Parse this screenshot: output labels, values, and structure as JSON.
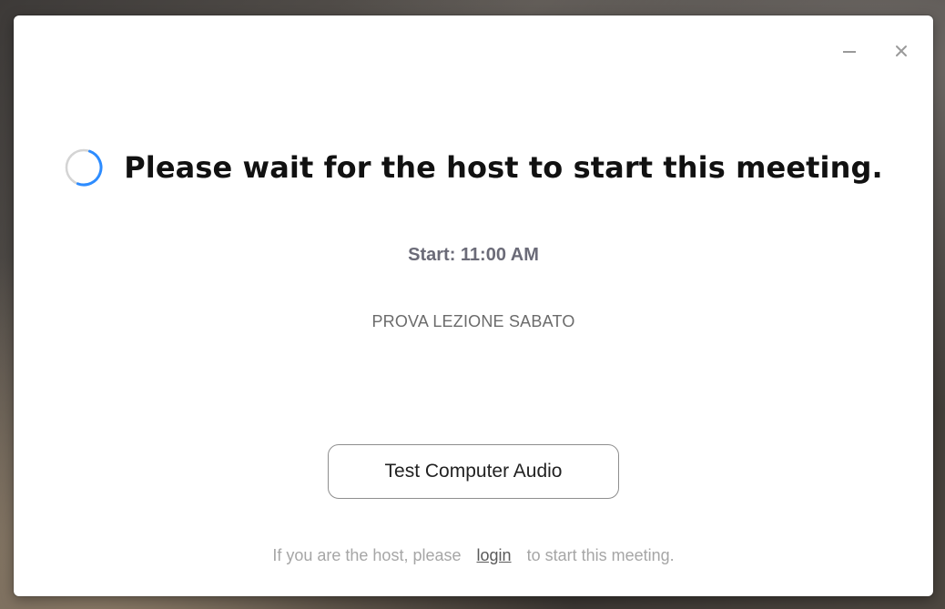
{
  "dialog": {
    "window_controls": {
      "minimize_icon": "minimize-icon",
      "close_icon": "close-icon"
    },
    "headline": {
      "spinner_icon": "loading-spinner-icon",
      "text": "Please wait for the host to start this meeting."
    },
    "start_time": "Start: 11:00 AM",
    "meeting_topic": "PROVA LEZIONE SABATO",
    "test_audio_button": "Test Computer Audio",
    "footer": {
      "prefix": "If you are the host, please",
      "link": "login",
      "suffix": "to start this meeting."
    }
  },
  "colors": {
    "spinner_track": "#d4d4d4",
    "spinner_arc": "#2d8cff",
    "title": "#111111",
    "start_time": "#6b6b78",
    "topic": "#6b6b6b",
    "footer_text": "#a6a6a6"
  }
}
